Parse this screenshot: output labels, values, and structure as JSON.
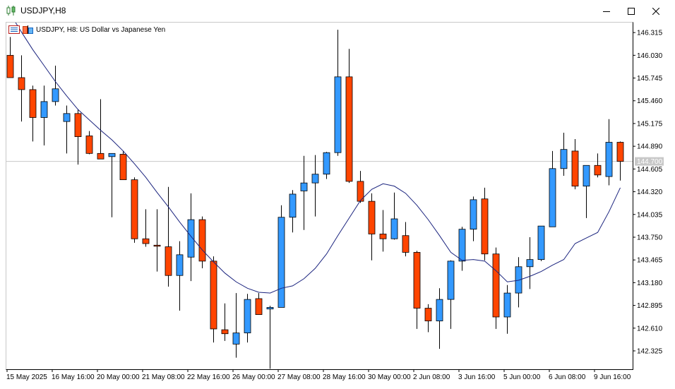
{
  "window": {
    "title": "USDJPY,H8",
    "minimize_icon": "minimize-icon",
    "maximize_icon": "maximize-icon",
    "close_icon": "close-icon"
  },
  "chart_header": {
    "text": "USDJPY, H8:  US Dollar vs Japanese Yen",
    "icons": [
      "indicator-list-icon",
      "chart-properties-icon"
    ]
  },
  "colors": {
    "bull": "#3399ff",
    "bear": "#ff4500",
    "ma_line": "#1a237e",
    "grid_line": "#c8c8c8",
    "price_label_bg": "#c8c8c8"
  },
  "chart_data": {
    "type": "candlestick",
    "symbol": "USDJPY",
    "timeframe": "H8",
    "y_ticks": [
      "146.315",
      "146.030",
      "145.745",
      "145.460",
      "145.175",
      "144.890",
      "144.605",
      "144.320",
      "144.035",
      "143.750",
      "143.465",
      "143.180",
      "142.895",
      "142.610",
      "142.325"
    ],
    "ylim": [
      142.095,
      146.44
    ],
    "current_price_label": "144.700",
    "current_price": 144.7,
    "x_ticks": [
      "15 May 2025",
      "16 May 16:00",
      "20 May 00:00",
      "21 May 08:00",
      "22 May 16:00",
      "26 May 00:00",
      "27 May 08:00",
      "28 May 16:00",
      "30 May 00:00",
      "2 Jun 08:00",
      "3 Jun 16:00",
      "5 Jun 00:00",
      "6 Jun 08:00",
      "9 Jun 16:00"
    ],
    "candles": [
      {
        "o": 146.03,
        "h": 146.26,
        "l": 145.75,
        "c": 145.75
      },
      {
        "o": 145.75,
        "h": 146.03,
        "l": 145.2,
        "c": 145.6
      },
      {
        "o": 145.6,
        "h": 145.65,
        "l": 144.95,
        "c": 145.25
      },
      {
        "o": 145.25,
        "h": 145.65,
        "l": 144.9,
        "c": 145.45
      },
      {
        "o": 145.45,
        "h": 145.9,
        "l": 145.4,
        "c": 145.61
      },
      {
        "o": 145.2,
        "h": 145.4,
        "l": 144.8,
        "c": 145.3
      },
      {
        "o": 145.3,
        "h": 145.35,
        "l": 144.66,
        "c": 145.01
      },
      {
        "o": 145.02,
        "h": 145.08,
        "l": 144.79,
        "c": 144.8
      },
      {
        "o": 144.8,
        "h": 145.48,
        "l": 144.73,
        "c": 144.73
      },
      {
        "o": 144.76,
        "h": 144.8,
        "l": 144.0,
        "c": 144.8
      },
      {
        "o": 144.79,
        "h": 144.83,
        "l": 144.5,
        "c": 144.47
      },
      {
        "o": 144.47,
        "h": 144.5,
        "l": 143.68,
        "c": 143.73
      },
      {
        "o": 143.73,
        "h": 144.1,
        "l": 143.63,
        "c": 143.67
      },
      {
        "o": 143.65,
        "h": 144.1,
        "l": 143.32,
        "c": 143.64
      },
      {
        "o": 143.63,
        "h": 144.38,
        "l": 143.13,
        "c": 143.27
      },
      {
        "o": 143.27,
        "h": 143.7,
        "l": 142.83,
        "c": 143.53
      },
      {
        "o": 143.5,
        "h": 144.3,
        "l": 143.2,
        "c": 143.97
      },
      {
        "o": 143.97,
        "h": 144.01,
        "l": 143.36,
        "c": 143.45
      },
      {
        "o": 143.45,
        "h": 143.51,
        "l": 142.43,
        "c": 142.6
      },
      {
        "o": 142.59,
        "h": 142.92,
        "l": 142.45,
        "c": 142.54
      },
      {
        "o": 142.41,
        "h": 143.05,
        "l": 142.24,
        "c": 142.55
      },
      {
        "o": 142.55,
        "h": 143.04,
        "l": 142.43,
        "c": 142.97
      },
      {
        "o": 142.98,
        "h": 143.05,
        "l": 142.78,
        "c": 142.78
      },
      {
        "o": 142.85,
        "h": 142.89,
        "l": 142.1,
        "c": 142.87
      },
      {
        "o": 142.87,
        "h": 144.15,
        "l": 142.87,
        "c": 144.0
      },
      {
        "o": 144.0,
        "h": 144.34,
        "l": 143.81,
        "c": 144.29
      },
      {
        "o": 144.33,
        "h": 144.77,
        "l": 143.84,
        "c": 144.43
      },
      {
        "o": 144.43,
        "h": 144.78,
        "l": 144.01,
        "c": 144.54
      },
      {
        "o": 144.54,
        "h": 144.82,
        "l": 144.48,
        "c": 144.81
      },
      {
        "o": 144.81,
        "h": 146.35,
        "l": 144.77,
        "c": 145.76
      },
      {
        "o": 145.76,
        "h": 146.11,
        "l": 144.43,
        "c": 144.45
      },
      {
        "o": 144.45,
        "h": 144.58,
        "l": 144.18,
        "c": 144.2
      },
      {
        "o": 144.2,
        "h": 144.3,
        "l": 143.46,
        "c": 143.79
      },
      {
        "o": 143.79,
        "h": 144.09,
        "l": 143.57,
        "c": 143.73
      },
      {
        "o": 143.73,
        "h": 144.31,
        "l": 143.72,
        "c": 143.98
      },
      {
        "o": 143.77,
        "h": 143.94,
        "l": 143.51,
        "c": 143.56
      },
      {
        "o": 143.56,
        "h": 143.58,
        "l": 142.6,
        "c": 142.86
      },
      {
        "o": 142.86,
        "h": 142.91,
        "l": 142.56,
        "c": 142.7
      },
      {
        "o": 142.7,
        "h": 143.11,
        "l": 142.35,
        "c": 142.97
      },
      {
        "o": 142.97,
        "h": 143.46,
        "l": 142.6,
        "c": 143.45
      },
      {
        "o": 143.45,
        "h": 143.88,
        "l": 143.33,
        "c": 143.85
      },
      {
        "o": 143.85,
        "h": 144.26,
        "l": 143.7,
        "c": 144.22
      },
      {
        "o": 144.23,
        "h": 144.37,
        "l": 143.46,
        "c": 143.54
      },
      {
        "o": 143.54,
        "h": 143.62,
        "l": 142.6,
        "c": 142.75
      },
      {
        "o": 142.75,
        "h": 143.15,
        "l": 142.54,
        "c": 143.05
      },
      {
        "o": 143.05,
        "h": 143.5,
        "l": 142.87,
        "c": 143.38
      },
      {
        "o": 143.38,
        "h": 143.75,
        "l": 143.1,
        "c": 143.47
      },
      {
        "o": 143.47,
        "h": 143.88,
        "l": 143.45,
        "c": 143.89
      },
      {
        "o": 143.88,
        "h": 144.83,
        "l": 143.88,
        "c": 144.61
      },
      {
        "o": 144.61,
        "h": 145.06,
        "l": 144.52,
        "c": 144.85
      },
      {
        "o": 144.83,
        "h": 144.98,
        "l": 144.35,
        "c": 144.39
      },
      {
        "o": 144.39,
        "h": 144.64,
        "l": 143.99,
        "c": 144.65
      },
      {
        "o": 144.65,
        "h": 144.8,
        "l": 144.5,
        "c": 144.53
      },
      {
        "o": 144.51,
        "h": 145.23,
        "l": 144.4,
        "c": 144.94
      },
      {
        "o": 144.94,
        "h": 144.95,
        "l": 144.46,
        "c": 144.7
      }
    ],
    "moving_average": [
      146.55,
      146.32,
      146.1,
      145.9,
      145.7,
      145.52,
      145.35,
      145.22,
      145.09,
      144.97,
      144.83,
      144.67,
      144.5,
      144.31,
      144.13,
      143.94,
      143.76,
      143.59,
      143.44,
      143.3,
      143.19,
      143.11,
      143.06,
      143.05,
      143.11,
      143.14,
      143.23,
      143.36,
      143.54,
      143.77,
      143.99,
      144.21,
      144.35,
      144.42,
      144.39,
      144.3,
      144.15,
      143.97,
      143.77,
      143.56,
      143.46,
      143.47,
      143.45,
      143.33,
      143.19,
      143.21,
      143.26,
      143.32,
      143.4,
      143.47,
      143.67,
      143.74,
      143.81,
      144.07,
      144.37
    ]
  }
}
